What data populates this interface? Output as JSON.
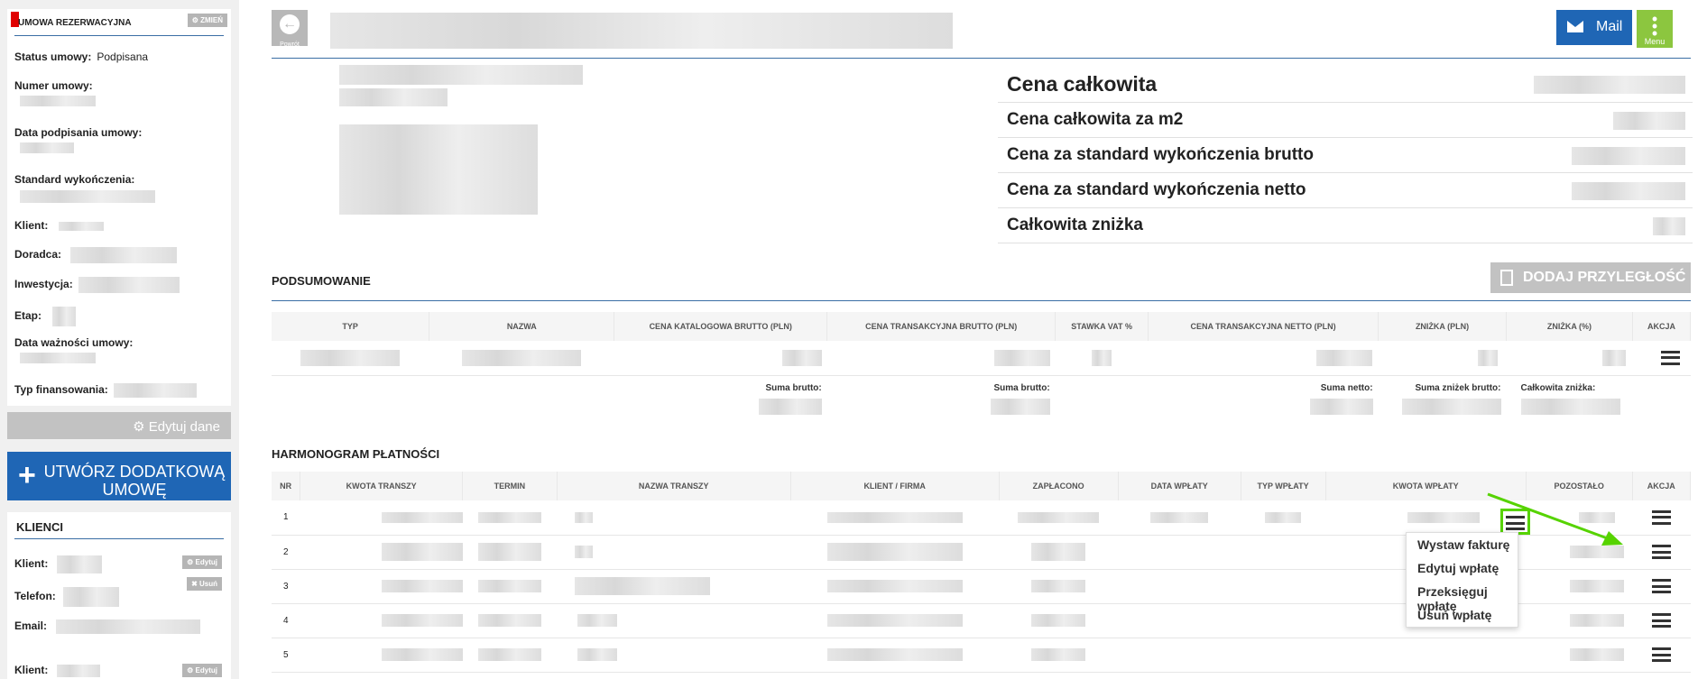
{
  "sidebar": {
    "contract_title": "UMOWA REZERWACYJNA",
    "change_label": "ZMIEŃ",
    "status_label": "Status umowy:",
    "status_value": "Podpisana",
    "contract_number_label": "Numer umowy:",
    "sign_date_label": "Data podpisania umowy:",
    "finish_standard_label": "Standard wykończenia:",
    "client_label": "Klient:",
    "advisor_label": "Doradca:",
    "investment_label": "Inwestycja:",
    "stage_label": "Etap:",
    "validity_label": "Data ważności umowy:",
    "financing_label": "Typ finansowania:",
    "edit_data_label": "Edytuj dane",
    "add_contract_label": "UTWÓRZ DODATKOWĄ UMOWĘ",
    "clients_title": "KLIENCI",
    "clients": [
      {
        "client_label": "Klient:",
        "phone_label": "Telefon:",
        "email_label": "Email:",
        "edit": "Edytuj",
        "delete": "Usuń"
      },
      {
        "client_label": "Klient:",
        "edit": "Edytuj"
      }
    ]
  },
  "header": {
    "back_label": "Powrót",
    "mail_label": "Mail",
    "menu_label": "Menu"
  },
  "prices": [
    "Cena całkowita",
    "Cena całkowita za m2",
    "Cena za standard wykończenia brutto",
    "Cena za standard wykończenia netto",
    "Całkowita zniżka"
  ],
  "summary": {
    "title": "PODSUMOWANIE",
    "add_property_label": "DODAJ PRZYLEGŁOŚĆ",
    "columns": [
      "TYP",
      "NAZWA",
      "CENA KATALOGOWA BRUTTO (PLN)",
      "CENA TRANSAKCYJNA BRUTTO (PLN)",
      "STAWKA VAT %",
      "CENA TRANSAKCYJNA NETTO (PLN)",
      "ZNIŻKA (PLN)",
      "ZNIŻKA (%)",
      "AKCJA"
    ],
    "totals": [
      "Suma brutto:",
      "Suma brutto:",
      "Suma netto:",
      "Suma zniżek brutto:",
      "Całkowita zniżka:"
    ]
  },
  "schedule": {
    "title": "HARMONOGRAM PŁATNOŚCI",
    "columns": [
      "NR",
      "KWOTA TRANSZY",
      "TERMIN",
      "NAZWA TRANSZY",
      "KLIENT / FIRMA",
      "ZAPŁACONO",
      "DATA WPŁATY",
      "TYP WPŁATY",
      "KWOTA WPŁATY",
      "POZOSTAŁO",
      "AKCJA"
    ],
    "rows": [
      "1",
      "2",
      "3",
      "4",
      "5"
    ]
  },
  "dropdown": [
    "Wystaw fakturę",
    "Edytuj wpłatę",
    "Przeksięguj wpłatę",
    "Usuń wpłatę"
  ],
  "colors": {
    "accent": "#1f66b5",
    "menu": "#8cc63f",
    "highlight": "#56d300",
    "status": "#e00000"
  }
}
